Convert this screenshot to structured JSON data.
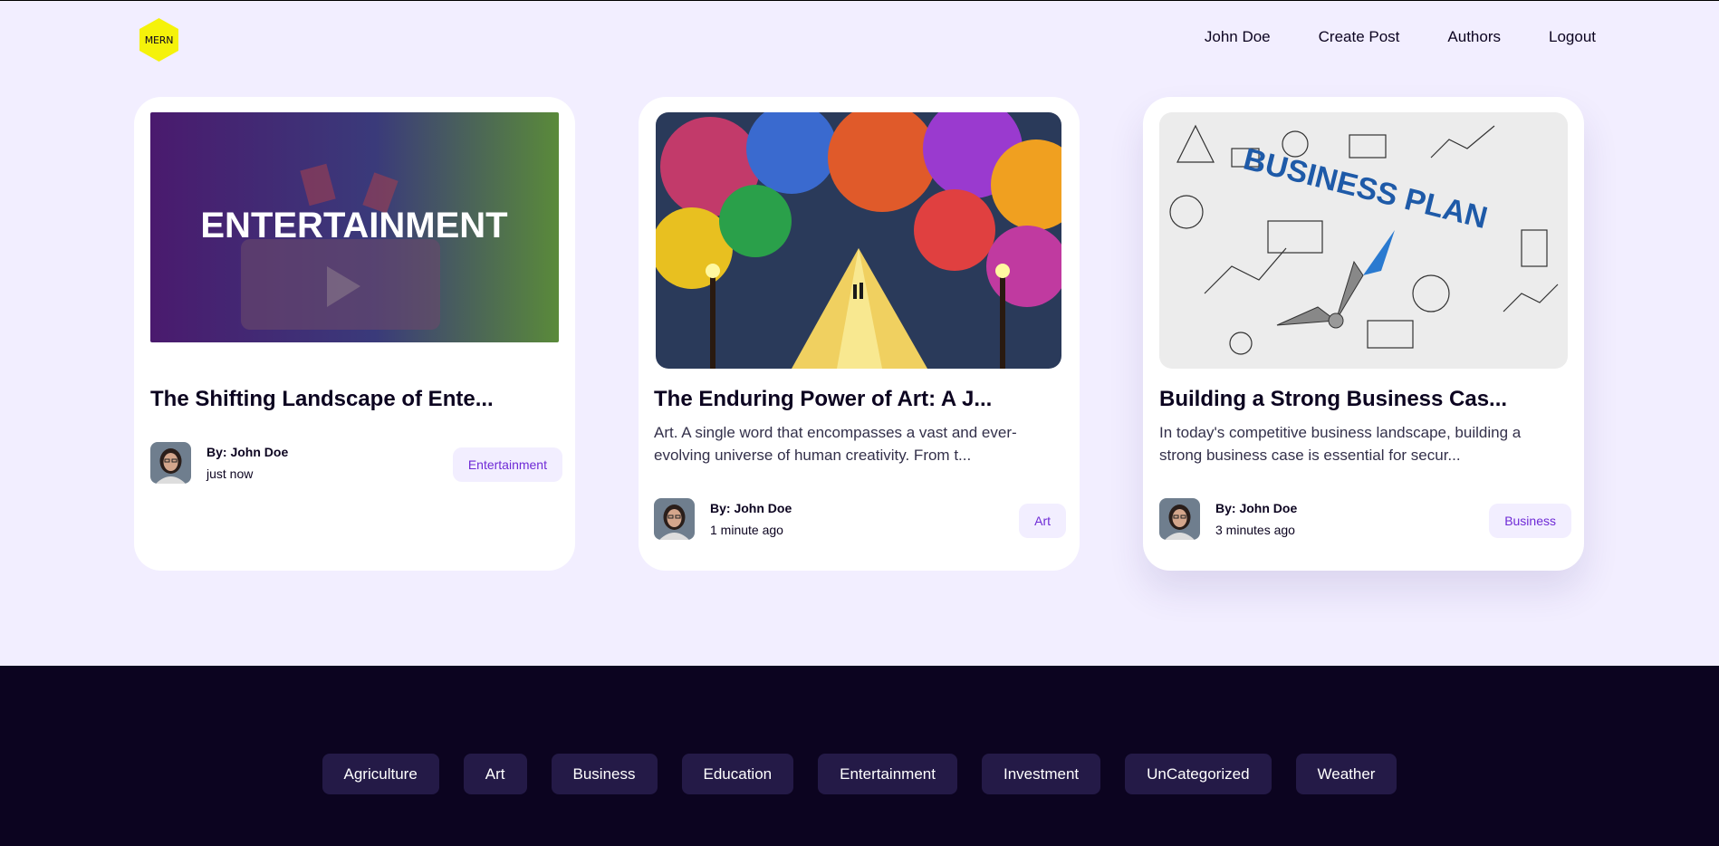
{
  "brand": {
    "logo_text": "MERN",
    "logo_color": "#f5f20a"
  },
  "nav": {
    "items": [
      {
        "label": "John Doe"
      },
      {
        "label": "Create Post"
      },
      {
        "label": "Authors"
      },
      {
        "label": "Logout"
      }
    ]
  },
  "posts": [
    {
      "image_text": "ENTERTAINMENT",
      "title": "The Shifting Landscape of Ente...",
      "excerpt": "",
      "author": "By: John Doe",
      "time": "just now",
      "category": "Entertainment"
    },
    {
      "image_text": "",
      "title": "The Enduring Power of Art: A J...",
      "excerpt": "Art. A single word that encompasses a vast and ever-evolving universe of human creativity. From t...",
      "author": "By: John Doe",
      "time": "1 minute ago",
      "category": "Art"
    },
    {
      "image_text": "BUSINESS PLAN",
      "title": "Building a Strong Business Cas...",
      "excerpt": "In today's competitive business landscape, building a strong business case is essential for secur...",
      "author": "By: John Doe",
      "time": "3 minutes ago",
      "category": "Business"
    }
  ],
  "footer": {
    "categories": [
      "Agriculture",
      "Art",
      "Business",
      "Education",
      "Entertainment",
      "Investment",
      "UnCategorized",
      "Weather"
    ]
  },
  "colors": {
    "page_bg": "#f2eeff",
    "dark": "#0c0420",
    "accent": "#6f2bd6",
    "footer_chip": "#241a47"
  }
}
